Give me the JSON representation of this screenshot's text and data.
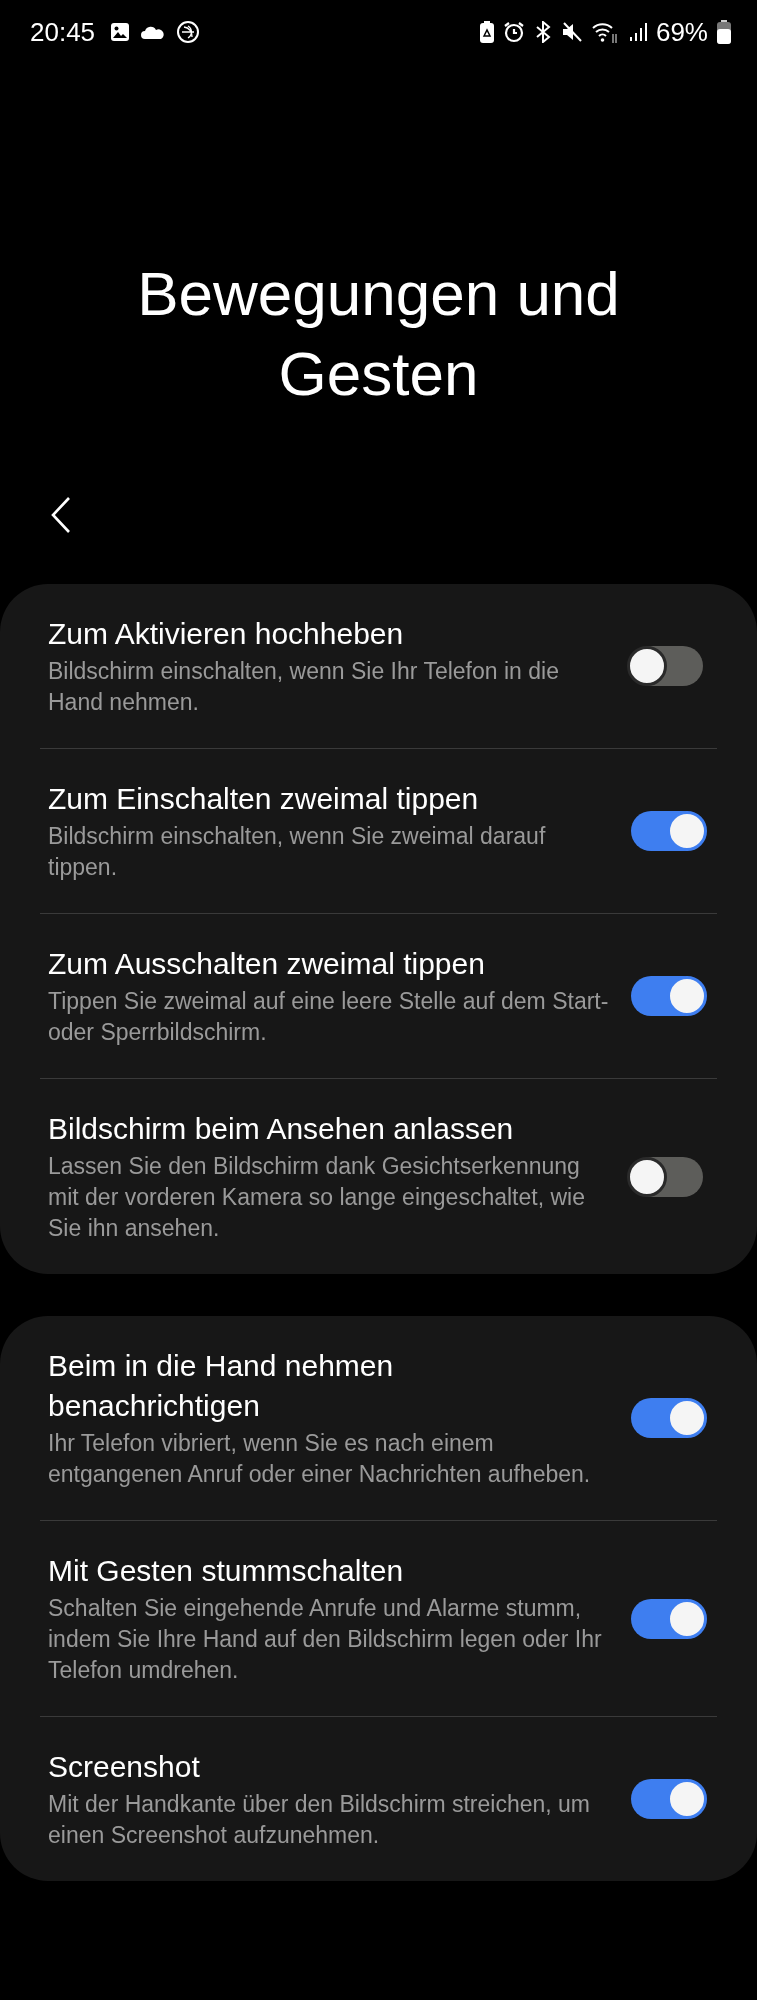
{
  "status_bar": {
    "time": "20:45",
    "battery": "69%"
  },
  "title": "Bewegungen und Gesten",
  "groups": [
    {
      "items": [
        {
          "title": "Zum Aktivieren hochheben",
          "description": "Bildschirm einschalten, wenn Sie Ihr Telefon in die Hand nehmen.",
          "on": false
        },
        {
          "title": "Zum Einschalten zweimal tippen",
          "description": "Bildschirm einschalten, wenn Sie zweimal darauf tippen.",
          "on": true
        },
        {
          "title": "Zum Ausschalten zweimal tippen",
          "description": "Tippen Sie zweimal auf eine leere Stelle auf dem Start- oder Sperrbildschirm.",
          "on": true
        },
        {
          "title": "Bildschirm beim Ansehen anlassen",
          "description": "Lassen Sie den Bildschirm dank Gesichtserkennung mit der vorderen Kamera so lange eingeschaltet, wie Sie ihn ansehen.",
          "on": false
        }
      ]
    },
    {
      "items": [
        {
          "title": "Beim in die Hand nehmen benachrichtigen",
          "description": "Ihr Telefon vibriert, wenn Sie es nach einem entgangenen Anruf oder einer Nachrichten aufheben.",
          "on": true
        },
        {
          "title": "Mit Gesten stummschalten",
          "description": "Schalten Sie eingehende Anrufe und Alarme stumm, indem Sie Ihre Hand auf den Bildschirm legen oder Ihr Telefon umdrehen.",
          "on": true
        },
        {
          "title": "Screenshot",
          "description": "Mit der Handkante über den Bildschirm streichen, um einen Screenshot aufzunehmen.",
          "on": true
        }
      ]
    }
  ]
}
